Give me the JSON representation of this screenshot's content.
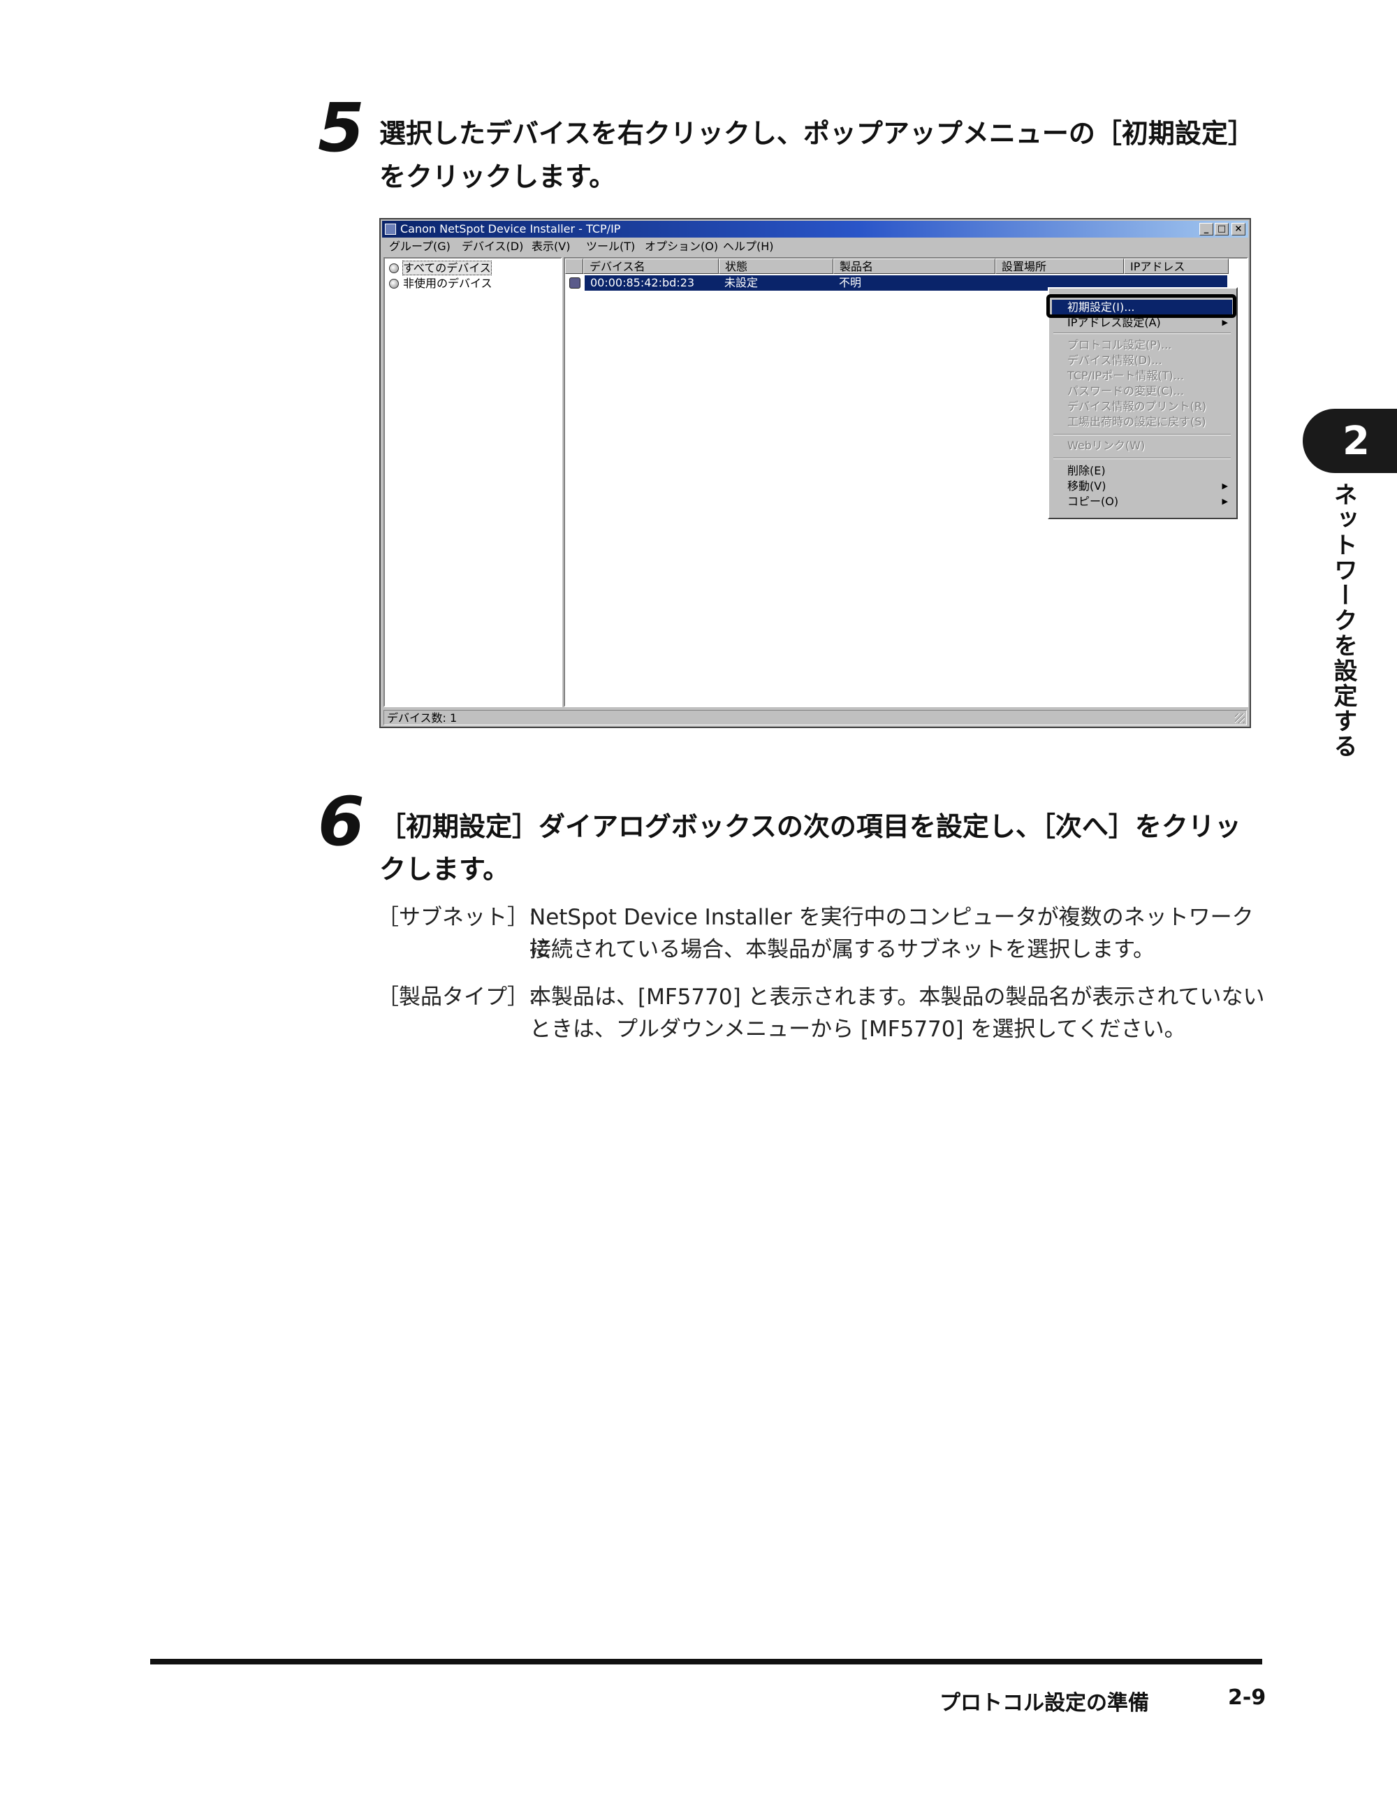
{
  "step5": {
    "number": "5",
    "line1": "選択したデバイスを右クリックし、ポップアップメニューの［初期設定］",
    "line2": "をクリックします。"
  },
  "screenshot": {
    "title": "Canon NetSpot Device Installer - TCP/IP",
    "controls": {
      "minimize": "_",
      "maximize": "□",
      "close": "×"
    },
    "menubar": [
      "グループ(G)",
      "デバイス(D)",
      "表示(V)",
      "ツール(T)",
      "オプション(O)",
      "ヘルプ(H)"
    ],
    "tree": [
      "すべてのデバイス",
      "非使用のデバイス"
    ],
    "columns": [
      "デバイス名",
      "状態",
      "製品名",
      "設置場所",
      "IPアドレス"
    ],
    "row": {
      "device_name": "00:00:85:42:bd:23",
      "status": "未設定",
      "product": "不明"
    },
    "context_menu": {
      "items": [
        {
          "label": "初期設定(I)...",
          "state": "highlighted"
        },
        {
          "label": "IPアドレス設定(A)",
          "state": "enabled"
        },
        {
          "label": "プロトコル設定(P)...",
          "state": "disabled"
        },
        {
          "label": "デバイス情報(D)...",
          "state": "disabled"
        },
        {
          "label": "TCP/IPポート情報(T)...",
          "state": "disabled"
        },
        {
          "label": "パスワードの変更(C)...",
          "state": "disabled"
        },
        {
          "label": "デバイス情報のプリント(R)",
          "state": "disabled"
        },
        {
          "label": "工場出荷時の設定に戻す(S)",
          "state": "disabled"
        },
        {
          "label": "Webリンク(W)",
          "state": "disabled"
        },
        {
          "label": "削除(E)",
          "state": "enabled"
        },
        {
          "label": "移動(V)",
          "state": "enabled",
          "submenu": true
        },
        {
          "label": "コピー(O)",
          "state": "enabled",
          "submenu": true
        }
      ]
    },
    "status": "デバイス数: 1"
  },
  "step6": {
    "number": "6",
    "line1": "［初期設定］ダイアログボックスの次の項目を設定し、［次へ］をクリッ",
    "line2": "クします。"
  },
  "descriptions": [
    {
      "label": "［サブネット］:",
      "line1": "NetSpot Device Installer を実行中のコンピュータが複数のネットワークに",
      "line2": "接続されている場合、本製品が属するサブネットを選択します。"
    },
    {
      "label": "［製品タイプ］:",
      "line1": "本製品は、[MF5770] と表示されます。本製品の製品名が表示されていない",
      "line2": "ときは、プルダウンメニューから [MF5770] を選択してください。"
    }
  ],
  "side_tab": {
    "number": "2",
    "text": "ネットワークを設定する"
  },
  "footer": {
    "title": "プロトコル設定の準備",
    "page": "2-9"
  }
}
